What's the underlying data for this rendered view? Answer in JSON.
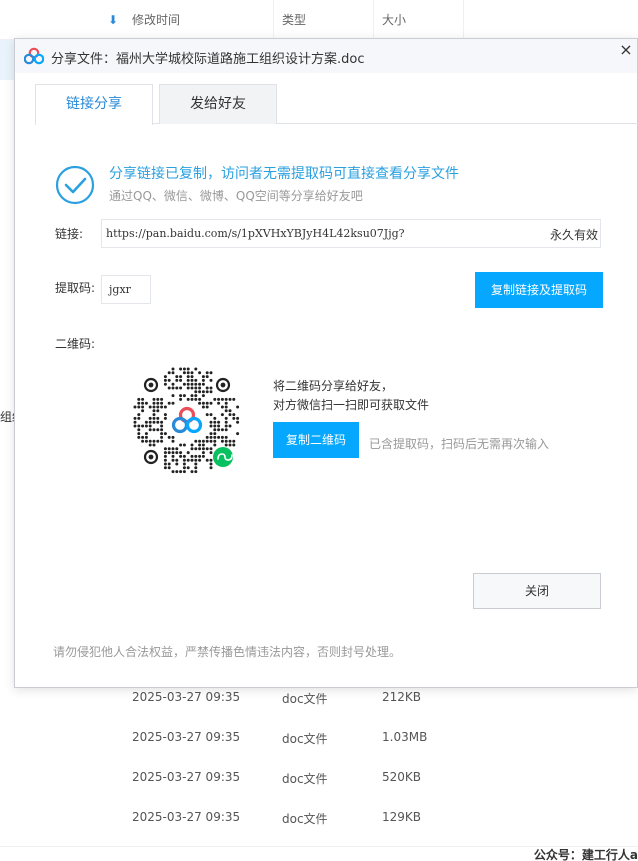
{
  "file_list": {
    "columns": {
      "modified": "修改时间",
      "type": "类型",
      "size": "大小"
    },
    "left_clipped_text": "组织",
    "rows": [
      {
        "date": "2025-03-27 09:35",
        "type": "doc文件",
        "size": "212KB"
      },
      {
        "date": "2025-03-27 09:35",
        "type": "doc文件",
        "size": "1.03MB"
      },
      {
        "date": "2025-03-27 09:35",
        "type": "doc文件",
        "size": "520KB"
      },
      {
        "date": "2025-03-27 09:35",
        "type": "doc文件",
        "size": "129KB"
      }
    ]
  },
  "dialog": {
    "title": "分享文件：福州大学城校际道路施工组织设计方案.doc",
    "close_glyph": "×",
    "tabs": [
      "链接分享",
      "发给好友"
    ],
    "success_title": "分享链接已复制，访问者无需提取码可直接查看分享文件",
    "success_subtitle": "通过QQ、微信、微博、QQ空间等分享给好友吧",
    "link_label": "链接:",
    "link_url": "https://pan.baidu.com/s/1pXVHxYBJyH4L42ksu07Jjg?",
    "link_expire": "永久有效",
    "code_label": "提取码:",
    "code_value": "jgxr",
    "copy_link_button": "复制链接及提取码",
    "qr_label": "二维码:",
    "qr_hint_line1": "将二维码分享给好友，",
    "qr_hint_line2": "对方微信扫一扫即可获取文件",
    "copy_qr_button": "复制二维码",
    "qr_note": "已含提取码，扫码后无需再次输入",
    "close_button": "关闭",
    "footer_note": "请勿侵犯他人合法权益，严禁传播色情违法内容，否则封号处理。"
  },
  "watermark": "公众号：建工行人a",
  "colors": {
    "accent": "#06a7ff",
    "link_blue": "#2a8ad7",
    "success": "#2aa0e0",
    "muted": "#999999",
    "wechat_green": "#07c160"
  }
}
